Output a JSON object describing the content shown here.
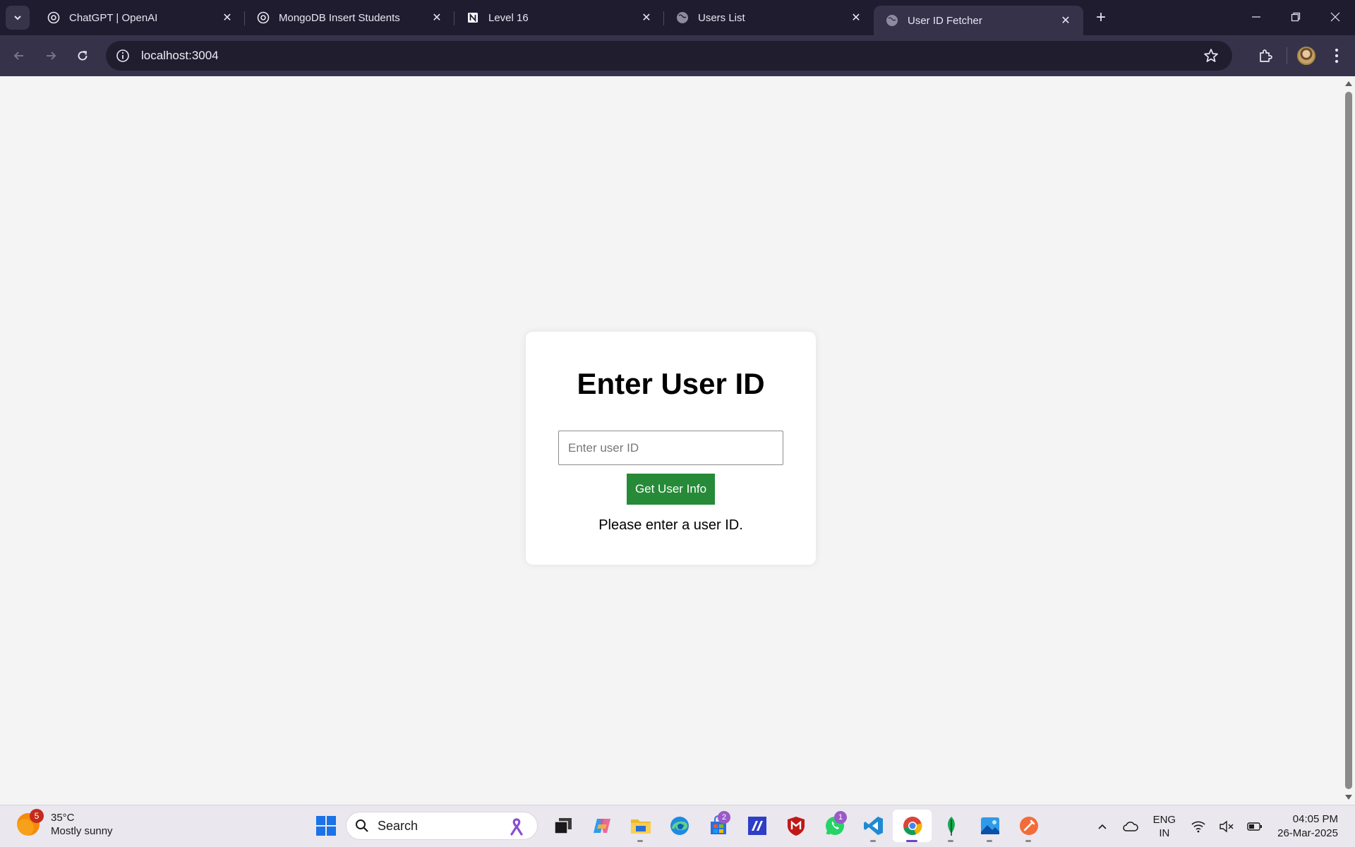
{
  "browser": {
    "tabs": [
      {
        "title": "ChatGPT | OpenAI",
        "icon": "openai-icon"
      },
      {
        "title": "MongoDB Insert Students",
        "icon": "openai-icon"
      },
      {
        "title": "Level 16",
        "icon": "notion-icon"
      },
      {
        "title": "Users List",
        "icon": "globe-icon"
      },
      {
        "title": "User ID Fetcher",
        "icon": "globe-icon",
        "active": true
      }
    ],
    "url": "localhost:3004"
  },
  "page": {
    "heading": "Enter User ID",
    "input_placeholder": "Enter user ID",
    "input_value": "",
    "button_label": "Get User Info",
    "message": "Please enter a user ID.",
    "button_color": "#268a38"
  },
  "taskbar": {
    "weather": {
      "temp": "35°C",
      "condition": "Mostly sunny",
      "badge": "5"
    },
    "search_label": "Search",
    "store_badge": "2",
    "whatsapp_badge": "1",
    "language": {
      "line1": "ENG",
      "line2": "IN"
    },
    "time": "04:05 PM",
    "date": "26-Mar-2025"
  }
}
